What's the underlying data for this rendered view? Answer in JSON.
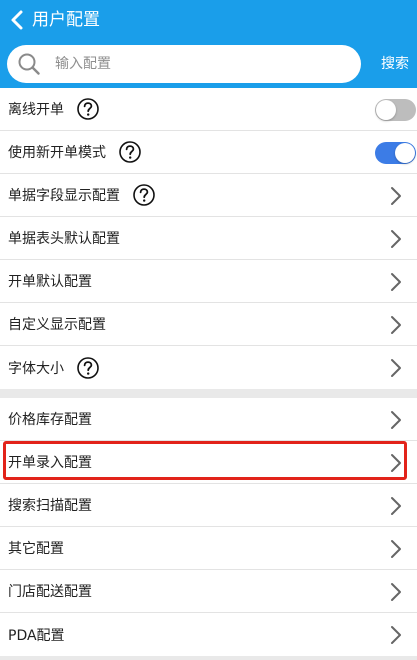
{
  "header": {
    "title": "用户配置",
    "back_icon": "chevron-left-icon",
    "bg_color": "#1a9eea"
  },
  "search": {
    "placeholder": "输入配置",
    "value": "",
    "button_label": "搜索",
    "icon": "search-icon"
  },
  "groups": [
    {
      "items": [
        {
          "label": "离线开单",
          "help": true,
          "control": "toggle",
          "state": "off"
        },
        {
          "label": "使用新开单模式",
          "help": true,
          "control": "toggle",
          "state": "on"
        },
        {
          "label": "单据字段显示配置",
          "help": true,
          "control": "chevron"
        },
        {
          "label": "单据表头默认配置",
          "help": false,
          "control": "chevron"
        },
        {
          "label": "开单默认配置",
          "help": false,
          "control": "chevron"
        },
        {
          "label": "自定义显示配置",
          "help": false,
          "control": "chevron"
        },
        {
          "label": "字体大小",
          "help": true,
          "control": "chevron"
        }
      ]
    },
    {
      "items": [
        {
          "label": "价格库存配置",
          "help": false,
          "control": "chevron"
        },
        {
          "label": "开单录入配置",
          "help": false,
          "control": "chevron",
          "highlighted": true
        },
        {
          "label": "搜索扫描配置",
          "help": false,
          "control": "chevron"
        },
        {
          "label": "其它配置",
          "help": false,
          "control": "chevron"
        },
        {
          "label": "门店配送配置",
          "help": false,
          "control": "chevron"
        },
        {
          "label": "PDA配置",
          "help": false,
          "control": "chevron"
        }
      ]
    }
  ],
  "colors": {
    "toggle_on": "#3c7ce6",
    "toggle_off": "#bdbdbd",
    "highlight": "#e2231a"
  }
}
